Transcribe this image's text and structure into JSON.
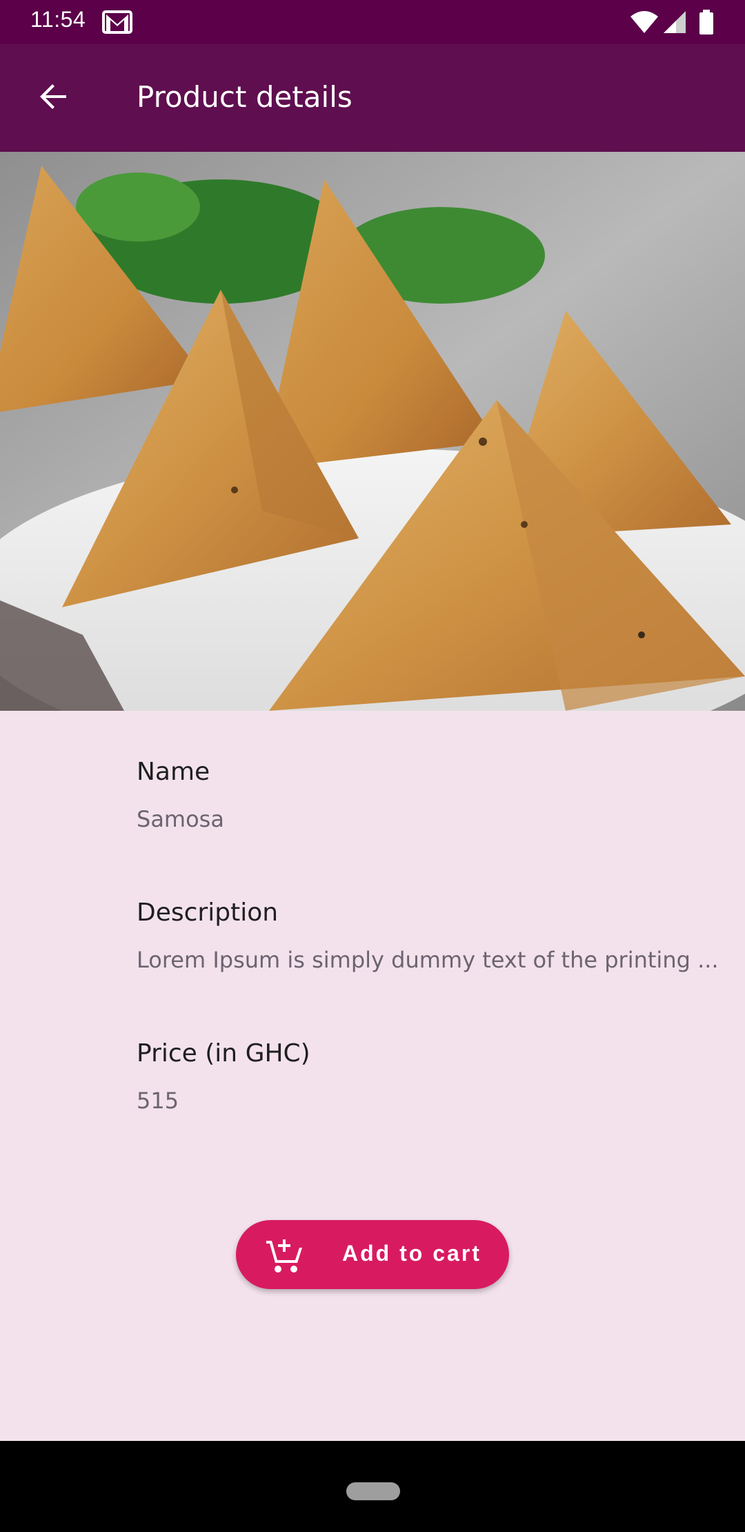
{
  "status_bar": {
    "time": "11:54",
    "icons": [
      "gmail-icon",
      "wifi-icon",
      "signal-icon",
      "battery-icon"
    ]
  },
  "app_bar": {
    "title": "Product details",
    "back_icon": "arrow-back-icon"
  },
  "product": {
    "name_label": "Name",
    "name_value": "Samosa",
    "description_label": "Description",
    "description_value": "Lorem Ipsum is simply dummy text of the printing ...",
    "price_label": "Price (in GHC)",
    "price_value": "515"
  },
  "add_to_cart": {
    "label": "Add to cart",
    "icon": "add-shopping-cart-icon"
  },
  "colors": {
    "status_bar": "#5b0049",
    "app_bar": "#5f0e4f",
    "background": "#f3e2ec",
    "accent": "#d81b60"
  }
}
